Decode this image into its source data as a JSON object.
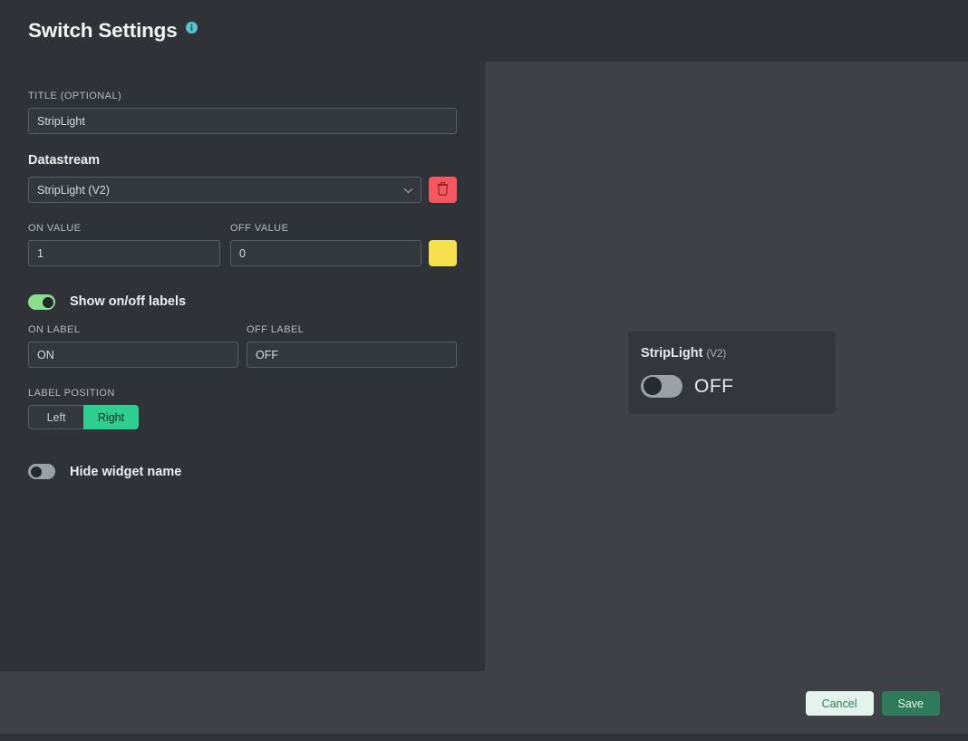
{
  "header": {
    "title": "Switch Settings",
    "info_icon": "info-icon"
  },
  "settings": {
    "title_field": {
      "label": "TITLE (OPTIONAL)",
      "value": "StripLight"
    },
    "datastream": {
      "heading": "Datastream",
      "selected": "StripLight (V2)",
      "chevron_icon": "chevron-down-icon",
      "delete_icon": "trash-icon"
    },
    "on_value": {
      "label": "ON VALUE",
      "value": "1"
    },
    "off_value": {
      "label": "OFF VALUE",
      "value": "0"
    },
    "color_swatch": {
      "name": "color-swatch",
      "color": "#f7e04e"
    },
    "show_labels_toggle": {
      "label": "Show on/off labels",
      "state": "on"
    },
    "on_label": {
      "label": "ON LABEL",
      "value": "ON"
    },
    "off_label": {
      "label": "OFF LABEL",
      "value": "OFF"
    },
    "label_position": {
      "label": "LABEL POSITION",
      "options": [
        "Left",
        "Right"
      ],
      "selected": "Right"
    },
    "hide_widget_toggle": {
      "label": "Hide widget name",
      "state": "off"
    }
  },
  "preview": {
    "widget": {
      "title": "StripLight",
      "pin": "(V2)",
      "toggle_state": "off",
      "state_label": "OFF"
    }
  },
  "footer": {
    "cancel_label": "Cancel",
    "save_label": "Save"
  },
  "colors": {
    "panel_bg": "#2f3338",
    "preview_bg": "#3e4247",
    "accent_green": "#2ece90",
    "toggle_on": "#8ade8c",
    "danger_red": "#f4575f",
    "info_teal": "#57c4cd",
    "swatch_yellow": "#f7e04e",
    "save_green": "#2f7a5a",
    "cancel_mint": "#e4f4ec"
  }
}
